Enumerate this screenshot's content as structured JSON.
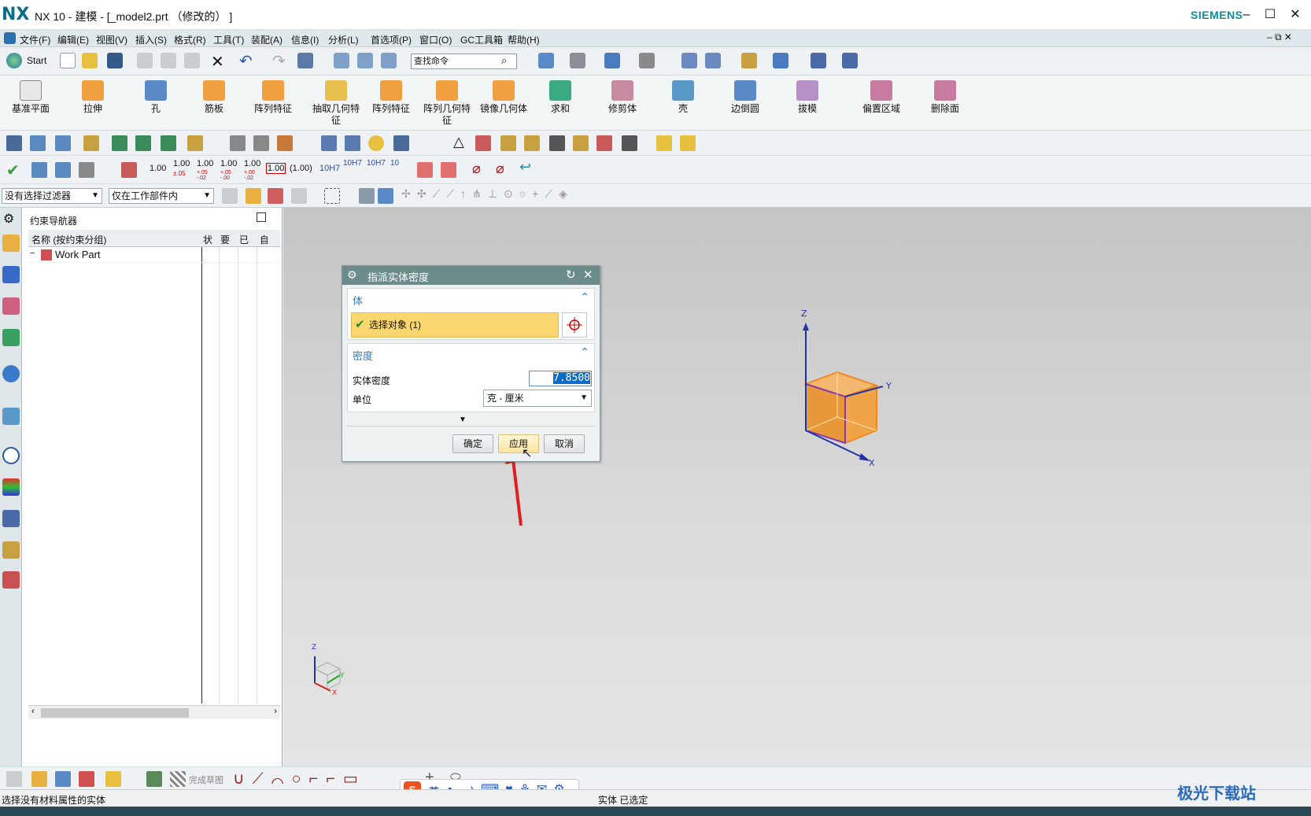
{
  "title_bar": {
    "logo": "NX",
    "title": "NX 10 - 建模 - [_model2.prt （修改的） ]",
    "brand": "SIEMENS"
  },
  "menu": [
    "文件(F)",
    "编辑(E)",
    "视图(V)",
    "插入(S)",
    "格式(R)",
    "工具(T)",
    "装配(A)",
    "信息(I)",
    "分析(L)",
    "首选项(P)",
    "窗口(O)",
    "GC工具箱",
    "帮助(H)"
  ],
  "toolbar": {
    "start_label": "Start",
    "search_placeholder": "查找命令"
  },
  "ribbon": [
    "基准平面",
    "拉伸",
    "孔",
    "筋板",
    "阵列特征",
    "抽取几何特征",
    "阵列特征",
    "阵列几何特征",
    "镜像几何体",
    "求和",
    "修剪体",
    "壳",
    "边倒圆",
    "拔模",
    "偏置区域",
    "删除面"
  ],
  "pmi_values": [
    "1.00",
    "1.00",
    "1.00",
    "1.00",
    "1.00",
    "1.00",
    "(1.00)",
    "10H7",
    "10H7",
    "10H7",
    "10"
  ],
  "pmi_sub": [
    "±.05",
    "+.05\n-.02",
    "+.05\n-.00",
    "+.00\n-.02"
  ],
  "filters": {
    "type_filter": "没有选择过滤器",
    "scope_filter": "仅在工作部件内"
  },
  "navigator": {
    "title": "约束导航器",
    "columns": [
      "名称 (按约束分组)",
      "状",
      "要",
      "已",
      "自"
    ],
    "root_item": "Work Part"
  },
  "dialog": {
    "title": "指派实体密度",
    "body_section": "体",
    "select_label": "选择对象 (1)",
    "density_section": "密度",
    "density_label": "实体密度",
    "density_value": "7.8500",
    "unit_label": "单位",
    "unit_value": "克 - 厘米",
    "ok": "确定",
    "apply": "应用",
    "cancel": "取消"
  },
  "viewport": {
    "axis_x": "X",
    "axis_y": "Y",
    "axis_z": "Z",
    "cube_color": "#f0a040"
  },
  "bottom_toolbar": {
    "finish_sketch": "完成草图"
  },
  "ime": {
    "lang": "英"
  },
  "status": {
    "left": "选择没有材料属性的实体",
    "right": "实体 已选定"
  },
  "watermark": "极光下载站"
}
